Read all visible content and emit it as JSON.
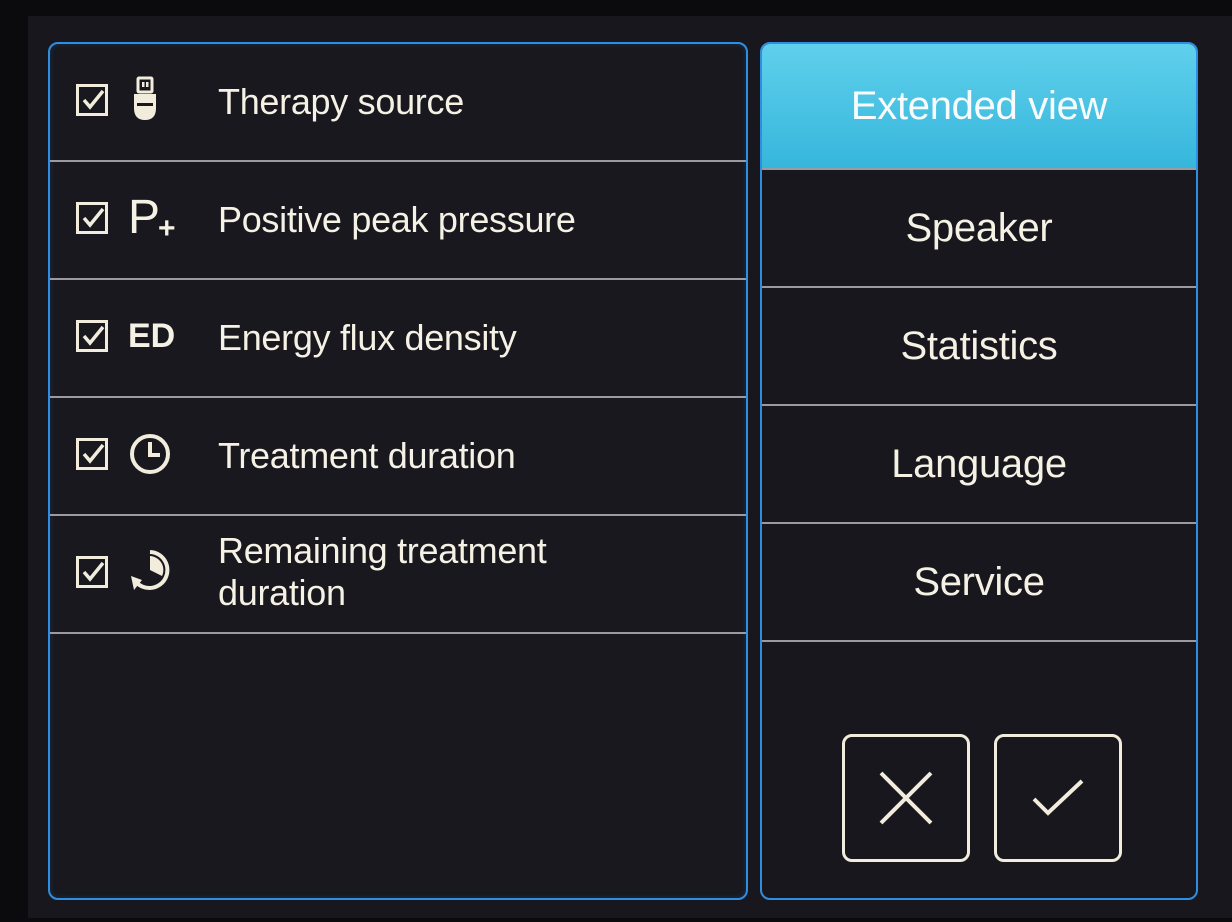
{
  "options": [
    {
      "label": "Therapy source",
      "checked": true,
      "icon": "usb-plug-icon"
    },
    {
      "label": "Positive peak pressure",
      "checked": true,
      "icon": "p-plus-icon",
      "icon_text": "P"
    },
    {
      "label": "Energy flux density",
      "checked": true,
      "icon": "ed-icon",
      "icon_text": "ED"
    },
    {
      "label": "Treatment duration",
      "checked": true,
      "icon": "clock-icon"
    },
    {
      "label": "Remaining treatment duration",
      "checked": true,
      "icon": "countdown-clock-icon"
    }
  ],
  "menu": {
    "items": [
      {
        "label": "Extended view",
        "active": true
      },
      {
        "label": "Speaker",
        "active": false
      },
      {
        "label": "Statistics",
        "active": false
      },
      {
        "label": "Language",
        "active": false
      },
      {
        "label": "Service",
        "active": false
      }
    ]
  },
  "actions": {
    "cancel_icon": "close-icon",
    "confirm_icon": "checkmark-icon"
  },
  "colors": {
    "accent_border": "#2f8ee0",
    "active_item": "#4cc4e6",
    "text": "#f5f1e4"
  }
}
